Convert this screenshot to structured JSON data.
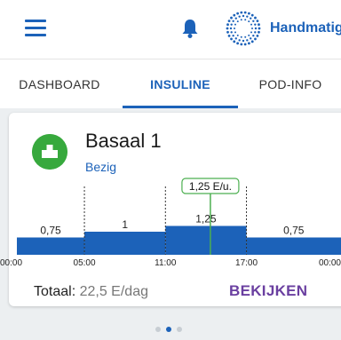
{
  "header": {
    "menu_icon": "hamburger-icon",
    "notification_icon": "bell-icon",
    "mode_icon": "dotted-circle-icon",
    "mode_label": "Handmatig"
  },
  "tabs": [
    {
      "label": "DASHBOARD",
      "active": false
    },
    {
      "label": "INSULINE",
      "active": true
    },
    {
      "label": "POD-INFO",
      "active": false
    }
  ],
  "card": {
    "icon": "basal-program-icon",
    "title": "Basaal 1",
    "status": "Bezig",
    "total_label": "Totaal:",
    "total_value": "22,5 E/dag",
    "view_label": "BEKIJKEN"
  },
  "chart_data": {
    "type": "step",
    "current_rate_label": "1,25 E/u.",
    "segments": [
      {
        "start": "00:00",
        "end": "05:00",
        "value": 0.75,
        "label": "0,75"
      },
      {
        "start": "05:00",
        "end": "11:00",
        "value": 1,
        "label": "1"
      },
      {
        "start": "11:00",
        "end": "17:00",
        "value": 1.25,
        "label": "1,25"
      },
      {
        "start": "17:00",
        "end": "00:00",
        "value": 0.75,
        "label": "0,75"
      }
    ],
    "x_ticks": [
      "00:00",
      "05:00",
      "11:00",
      "17:00",
      "00:00"
    ],
    "colors": {
      "bar": "#1c62b9",
      "current_marker": "#4caf50"
    }
  },
  "pager": {
    "count": 3,
    "active_index": 1
  },
  "colors": {
    "accent": "#1c62b9",
    "link": "#6a3fa0",
    "basal_icon": "#37a93d"
  }
}
